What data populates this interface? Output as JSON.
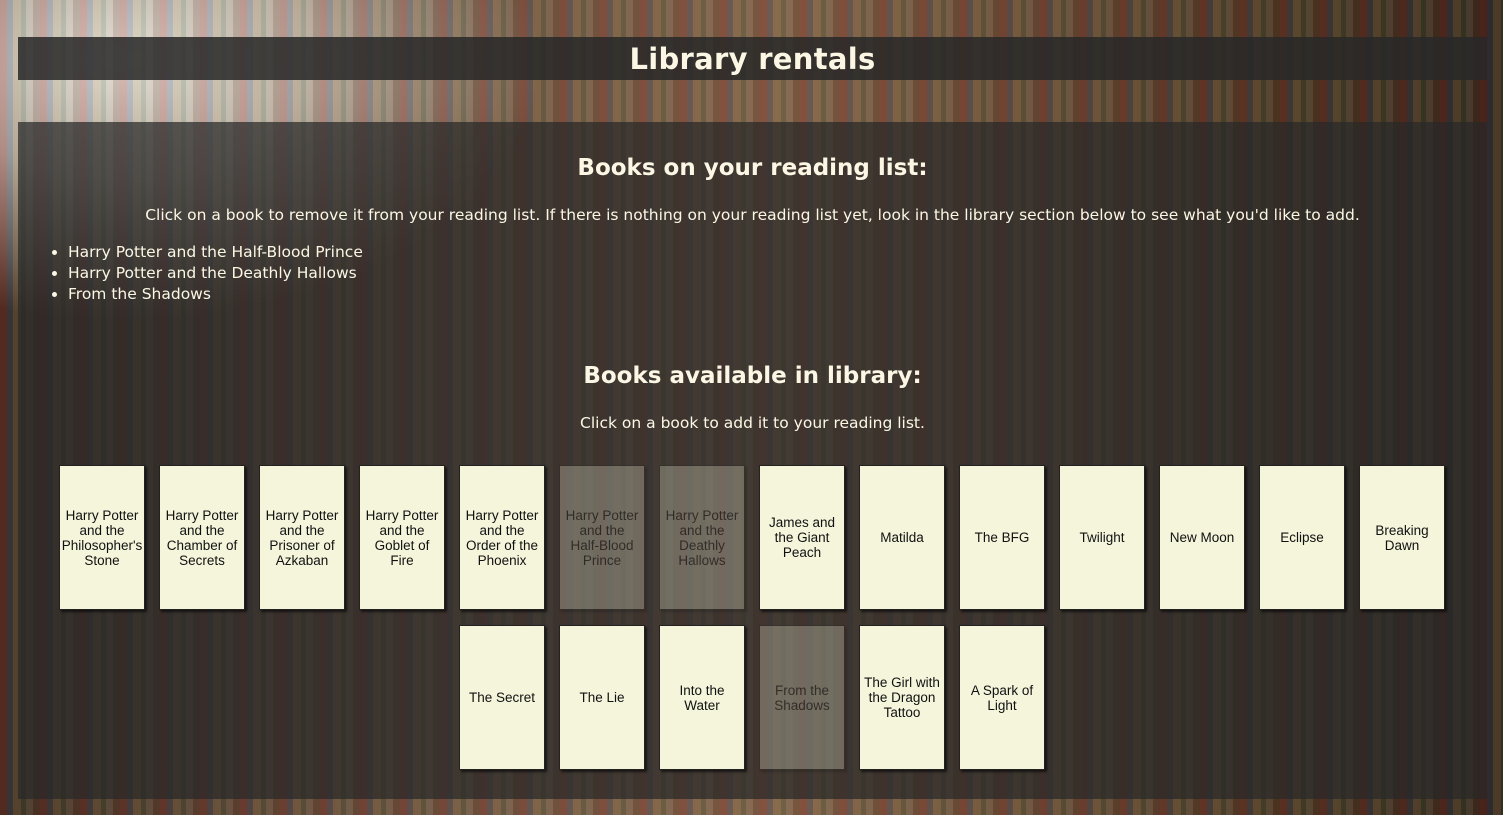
{
  "header": {
    "title": "Library rentals"
  },
  "reading_list": {
    "heading": "Books on your reading list:",
    "instruction": "Click on a book to remove it from your reading list. If there is nothing on your reading list yet, look in the library section below to see what you'd like to add.",
    "items": [
      "Harry Potter and the Half-Blood Prince",
      "Harry Potter and the Deathly Hallows",
      "From the Shadows"
    ]
  },
  "library": {
    "heading": "Books available in library:",
    "instruction": "Click on a book to add it to your reading list.",
    "books": [
      {
        "title": "Harry Potter and the Philosopher's Stone",
        "available": true
      },
      {
        "title": "Harry Potter and the Chamber of Secrets",
        "available": true
      },
      {
        "title": "Harry Potter and the Prisoner of Azkaban",
        "available": true
      },
      {
        "title": "Harry Potter and the Goblet of Fire",
        "available": true
      },
      {
        "title": "Harry Potter and the Order of the Phoenix",
        "available": true
      },
      {
        "title": "Harry Potter and the Half-Blood Prince",
        "available": false
      },
      {
        "title": "Harry Potter and the Deathly Hallows",
        "available": false
      },
      {
        "title": "James and the Giant Peach",
        "available": true
      },
      {
        "title": "Matilda",
        "available": true
      },
      {
        "title": "The BFG",
        "available": true
      },
      {
        "title": "Twilight",
        "available": true
      },
      {
        "title": "New Moon",
        "available": true
      },
      {
        "title": "Eclipse",
        "available": true
      },
      {
        "title": "Breaking Dawn",
        "available": true
      },
      {
        "title": "The Secret",
        "available": true
      },
      {
        "title": "The Lie",
        "available": true
      },
      {
        "title": "Into the Water",
        "available": true
      },
      {
        "title": "From the Shadows",
        "available": false
      },
      {
        "title": "The Girl with the Dragon Tattoo",
        "available": true
      },
      {
        "title": "A Spark of Light",
        "available": true
      }
    ]
  }
}
